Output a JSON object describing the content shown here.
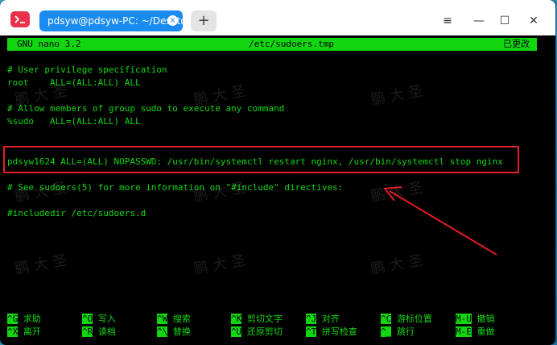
{
  "window": {
    "tab_title": "pdsyw@pdsyw-PC: ~/Desktop",
    "tab_close_glyph": "×",
    "new_tab_glyph": "+",
    "controls": {
      "menu": "≡",
      "minimize": "—",
      "maximize": "☐",
      "close": "✕"
    }
  },
  "nano": {
    "version": "GNU nano 3.2",
    "filename": "/etc/sudoers.tmp",
    "status": "已更改"
  },
  "file_lines": [
    "# User privilege specification",
    "root    ALL=(ALL:ALL) ALL",
    "",
    "# Allow members of group sudo to execute any command",
    "%sudo   ALL=(ALL:ALL) ALL",
    "",
    "",
    "pdsyw1624 ALL=(ALL) NOPASSWD: /usr/bin/systemctl restart nginx, /usr/bin/systemctl stop nginx",
    "",
    "# See sudoers(5) for more information on \"#include\" directives:",
    "",
    "#includedir /etc/sudoers.d"
  ],
  "shortcuts": [
    [
      {
        "key": "^G",
        "label": "求助"
      },
      {
        "key": "^O",
        "label": "写入"
      },
      {
        "key": "^W",
        "label": "搜索"
      },
      {
        "key": "^K",
        "label": "剪切文字"
      },
      {
        "key": "^J",
        "label": "对齐"
      },
      {
        "key": "^C",
        "label": "游标位置"
      },
      {
        "key": "M-U",
        "label": "撤销"
      }
    ],
    [
      {
        "key": "^X",
        "label": "离开"
      },
      {
        "key": "^R",
        "label": "读档"
      },
      {
        "key": "^\\",
        "label": "替换"
      },
      {
        "key": "^U",
        "label": "还原剪切"
      },
      {
        "key": "^T",
        "label": "拼写检查"
      },
      {
        "key": "^_",
        "label": "跳行"
      },
      {
        "key": "M-E",
        "label": "重做"
      }
    ]
  ],
  "watermark": "鹏 大 圣",
  "colors": {
    "terminal_bg": "#000000",
    "terminal_fg": "#11d711",
    "tab_blue": "#1a8cf0",
    "annotation_red": "#e21b25"
  }
}
